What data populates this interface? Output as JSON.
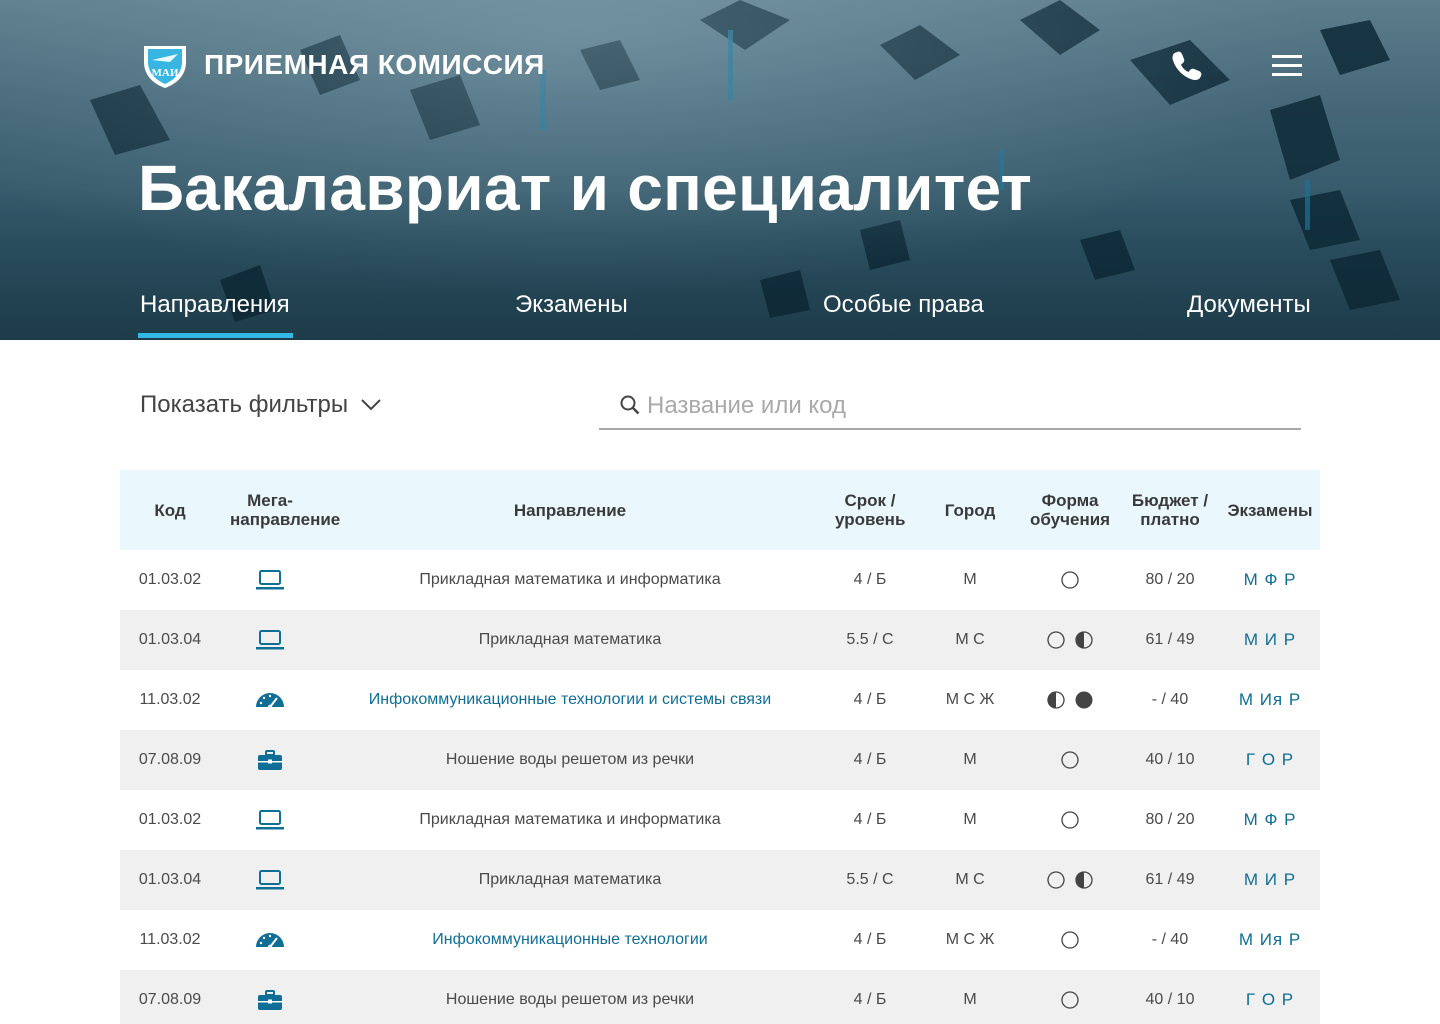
{
  "header": {
    "brand": "ПРИЕМНАЯ КОМИССИЯ",
    "logo_text": "МАИ",
    "title": "Бакалавриат и специалитет"
  },
  "tabs": [
    {
      "label": "Направления",
      "active": true
    },
    {
      "label": "Экзамены",
      "active": false
    },
    {
      "label": "Особые права",
      "active": false
    },
    {
      "label": "Документы",
      "active": false
    }
  ],
  "filters": {
    "toggle_label": "Показать фильтры",
    "search_placeholder": "Название или код",
    "search_value": ""
  },
  "table": {
    "headers": {
      "code": "Код",
      "mega": "Мега-направление",
      "direction": "Направление",
      "term": "Срок / уровень",
      "city": "Город",
      "form": "Форма обучения",
      "budget": "Бюджет / платно",
      "exams": "Экзамены"
    },
    "rows": [
      {
        "code": "01.03.02",
        "mega_icon": "laptop-icon",
        "direction": "Прикладная математика и информатика",
        "link": false,
        "term": "4 / Б",
        "city": "М",
        "forms": [
          "full-time-icon"
        ],
        "budget": "80 / 20",
        "exams": "М Ф Р"
      },
      {
        "code": "01.03.04",
        "mega_icon": "laptop-icon",
        "direction": "Прикладная математика",
        "link": false,
        "term": "5.5 / С",
        "city": "М С",
        "forms": [
          "full-time-icon",
          "part-time-icon"
        ],
        "budget": "61 / 49",
        "exams": "М И Р"
      },
      {
        "code": "11.03.02",
        "mega_icon": "gauge-icon",
        "direction": "Инфокоммуникационные технологии и системы связи",
        "link": true,
        "term": "4 / Б",
        "city": "М С Ж",
        "forms": [
          "part-time-icon",
          "extramural-icon"
        ],
        "budget": "- / 40",
        "exams": "М Ия Р"
      },
      {
        "code": "07.08.09",
        "mega_icon": "briefcase-icon",
        "direction": "Ношение воды решетом из речки",
        "link": false,
        "term": "4 / Б",
        "city": "М",
        "forms": [
          "full-time-icon"
        ],
        "budget": "40 / 10",
        "exams": "Г О Р"
      },
      {
        "code": "01.03.02",
        "mega_icon": "laptop-icon",
        "direction": "Прикладная математика и информатика",
        "link": false,
        "term": "4 / Б",
        "city": "М",
        "forms": [
          "full-time-icon"
        ],
        "budget": "80 / 20",
        "exams": "М Ф Р"
      },
      {
        "code": "01.03.04",
        "mega_icon": "laptop-icon",
        "direction": "Прикладная математика",
        "link": false,
        "term": "5.5 / С",
        "city": "М С",
        "forms": [
          "full-time-icon",
          "part-time-icon"
        ],
        "budget": "61 / 49",
        "exams": "М И Р"
      },
      {
        "code": "11.03.02",
        "mega_icon": "gauge-icon",
        "direction": "Инфокоммуникационные технологии",
        "link": true,
        "term": "4 / Б",
        "city": "М С Ж",
        "forms": [
          "full-time-icon"
        ],
        "budget": "- / 40",
        "exams": "М Ия Р"
      },
      {
        "code": "07.08.09",
        "mega_icon": "briefcase-icon",
        "direction": "Ношение воды решетом из речки",
        "link": false,
        "term": "4 / Б",
        "city": "М",
        "forms": [
          "full-time-icon"
        ],
        "budget": "40 / 10",
        "exams": "Г О Р"
      }
    ]
  },
  "colors": {
    "accent": "#34b9e4",
    "link": "#0f6e96",
    "header_row_bg": "#eaf8fd",
    "alt_row_bg": "#f0f0f0"
  }
}
